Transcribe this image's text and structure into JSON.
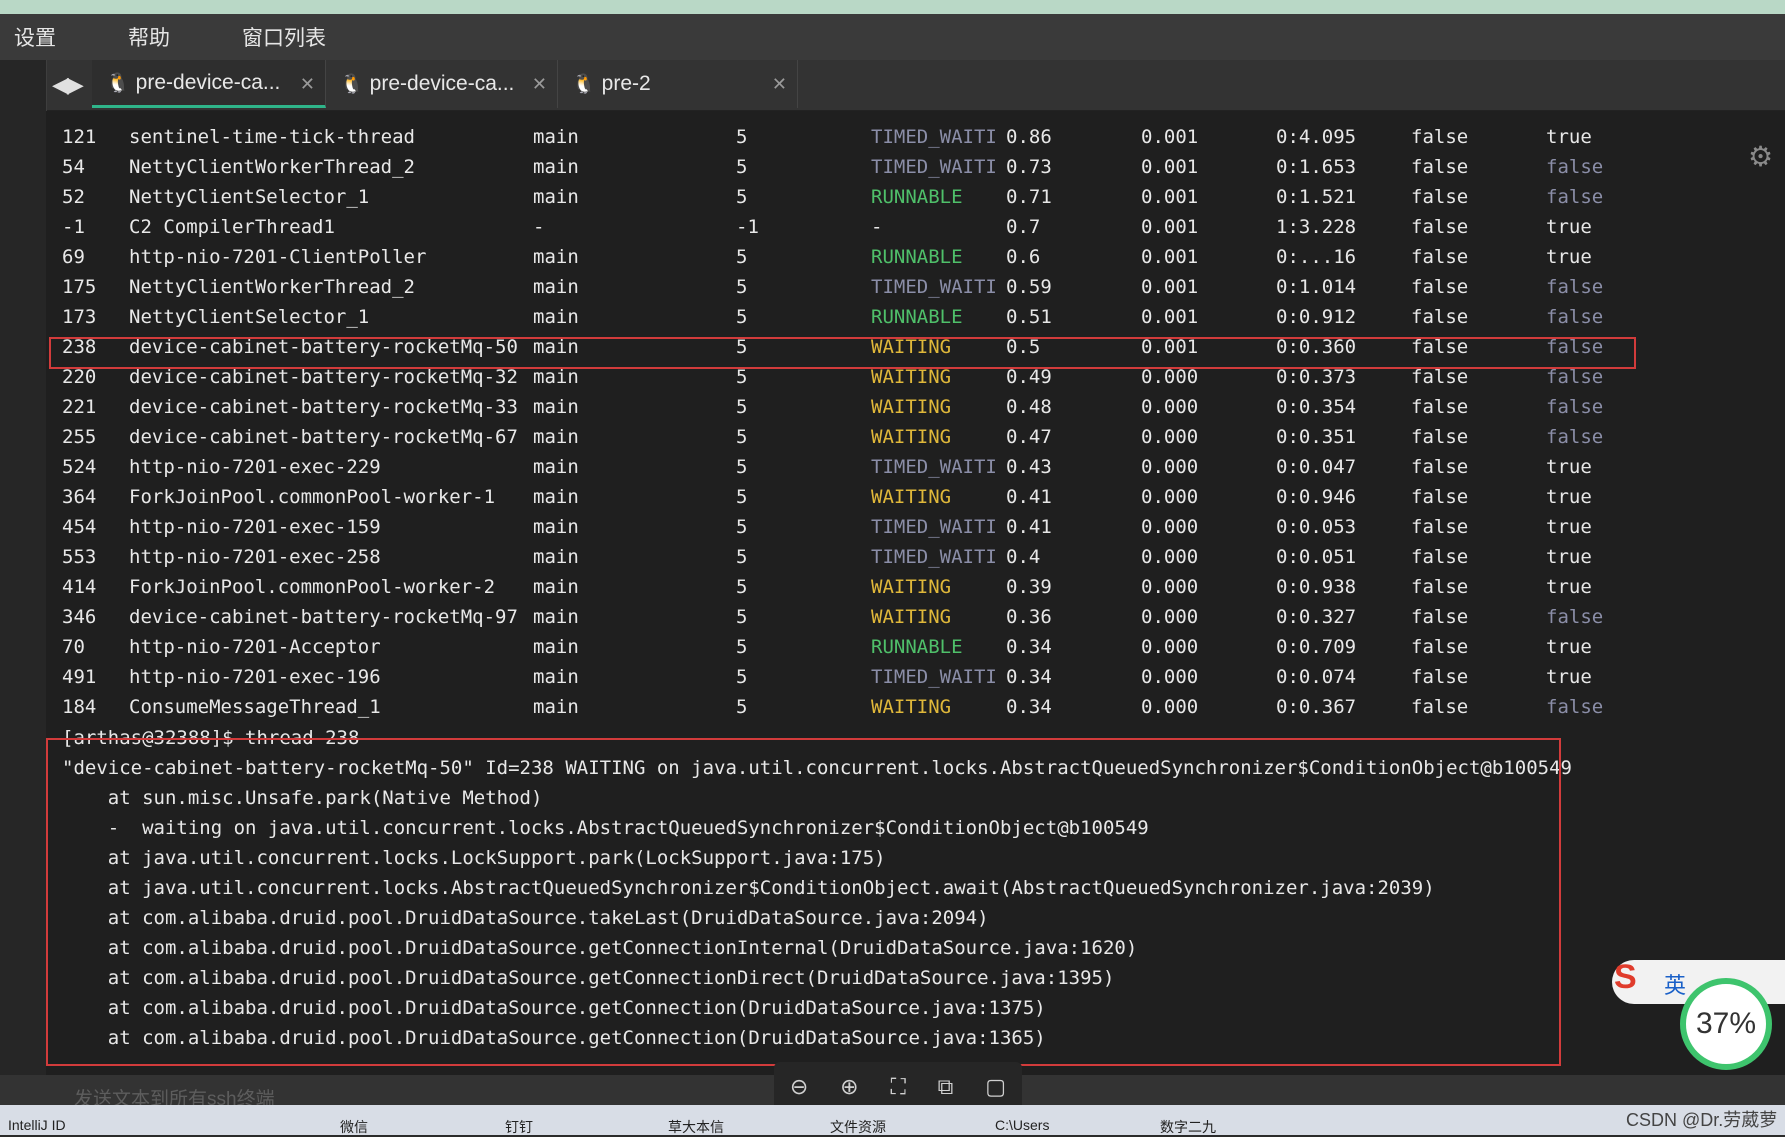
{
  "menu": [
    "设置",
    "帮助",
    "窗口列表"
  ],
  "tabs": [
    {
      "label": "pre-device-ca...",
      "active": true
    },
    {
      "label": "pre-device-ca...",
      "active": false
    },
    {
      "label": "pre-2",
      "active": false
    }
  ],
  "threads": [
    {
      "id": "121",
      "name": "sentinel-time-tick-thread",
      "group": "main",
      "priority": "5",
      "state": "TIMED_WAITI",
      "cpu": "0.86",
      "delta": "0.001",
      "time": "0:4.095",
      "interrupted": "false",
      "daemon": "true"
    },
    {
      "id": "54",
      "name": "NettyClientWorkerThread_2",
      "group": "main",
      "priority": "5",
      "state": "TIMED_WAITI",
      "cpu": "0.73",
      "delta": "0.001",
      "time": "0:1.653",
      "interrupted": "false",
      "daemon": "false"
    },
    {
      "id": "52",
      "name": "NettyClientSelector_1",
      "group": "main",
      "priority": "5",
      "state": "RUNNABLE",
      "cpu": "0.71",
      "delta": "0.001",
      "time": "0:1.521",
      "interrupted": "false",
      "daemon": "false"
    },
    {
      "id": "-1",
      "name": "C2 CompilerThread1",
      "group": "-",
      "priority": "-1",
      "state": "-",
      "cpu": "0.7",
      "delta": "0.001",
      "time": "1:3.228",
      "interrupted": "false",
      "daemon": "true"
    },
    {
      "id": "69",
      "name": "http-nio-7201-ClientPoller",
      "group": "main",
      "priority": "5",
      "state": "RUNNABLE",
      "cpu": "0.6",
      "delta": "0.001",
      "time": "0:...16",
      "interrupted": "false",
      "daemon": "true"
    },
    {
      "id": "175",
      "name": "NettyClientWorkerThread_2",
      "group": "main",
      "priority": "5",
      "state": "TIMED_WAITI",
      "cpu": "0.59",
      "delta": "0.001",
      "time": "0:1.014",
      "interrupted": "false",
      "daemon": "false"
    },
    {
      "id": "173",
      "name": "NettyClientSelector_1",
      "group": "main",
      "priority": "5",
      "state": "RUNNABLE",
      "cpu": "0.51",
      "delta": "0.001",
      "time": "0:0.912",
      "interrupted": "false",
      "daemon": "false"
    },
    {
      "id": "238",
      "name": "device-cabinet-battery-rocketMq-50",
      "group": "main",
      "priority": "5",
      "state": "WAITING",
      "cpu": "0.5",
      "delta": "0.001",
      "time": "0:0.360",
      "interrupted": "false",
      "daemon": "false"
    },
    {
      "id": "220",
      "name": "device-cabinet-battery-rocketMq-32",
      "group": "main",
      "priority": "5",
      "state": "WAITING",
      "cpu": "0.49",
      "delta": "0.000",
      "time": "0:0.373",
      "interrupted": "false",
      "daemon": "false"
    },
    {
      "id": "221",
      "name": "device-cabinet-battery-rocketMq-33",
      "group": "main",
      "priority": "5",
      "state": "WAITING",
      "cpu": "0.48",
      "delta": "0.000",
      "time": "0:0.354",
      "interrupted": "false",
      "daemon": "false"
    },
    {
      "id": "255",
      "name": "device-cabinet-battery-rocketMq-67",
      "group": "main",
      "priority": "5",
      "state": "WAITING",
      "cpu": "0.47",
      "delta": "0.000",
      "time": "0:0.351",
      "interrupted": "false",
      "daemon": "false"
    },
    {
      "id": "524",
      "name": "http-nio-7201-exec-229",
      "group": "main",
      "priority": "5",
      "state": "TIMED_WAITI",
      "cpu": "0.43",
      "delta": "0.000",
      "time": "0:0.047",
      "interrupted": "false",
      "daemon": "true"
    },
    {
      "id": "364",
      "name": "ForkJoinPool.commonPool-worker-1",
      "group": "main",
      "priority": "5",
      "state": "WAITING",
      "cpu": "0.41",
      "delta": "0.000",
      "time": "0:0.946",
      "interrupted": "false",
      "daemon": "true"
    },
    {
      "id": "454",
      "name": "http-nio-7201-exec-159",
      "group": "main",
      "priority": "5",
      "state": "TIMED_WAITI",
      "cpu": "0.41",
      "delta": "0.000",
      "time": "0:0.053",
      "interrupted": "false",
      "daemon": "true"
    },
    {
      "id": "553",
      "name": "http-nio-7201-exec-258",
      "group": "main",
      "priority": "5",
      "state": "TIMED_WAITI",
      "cpu": "0.4",
      "delta": "0.000",
      "time": "0:0.051",
      "interrupted": "false",
      "daemon": "true"
    },
    {
      "id": "414",
      "name": "ForkJoinPool.commonPool-worker-2",
      "group": "main",
      "priority": "5",
      "state": "WAITING",
      "cpu": "0.39",
      "delta": "0.000",
      "time": "0:0.938",
      "interrupted": "false",
      "daemon": "true"
    },
    {
      "id": "346",
      "name": "device-cabinet-battery-rocketMq-97",
      "group": "main",
      "priority": "5",
      "state": "WAITING",
      "cpu": "0.36",
      "delta": "0.000",
      "time": "0:0.327",
      "interrupted": "false",
      "daemon": "false"
    },
    {
      "id": "70",
      "name": "http-nio-7201-Acceptor",
      "group": "main",
      "priority": "5",
      "state": "RUNNABLE",
      "cpu": "0.34",
      "delta": "0.000",
      "time": "0:0.709",
      "interrupted": "false",
      "daemon": "true"
    },
    {
      "id": "491",
      "name": "http-nio-7201-exec-196",
      "group": "main",
      "priority": "5",
      "state": "TIMED_WAITI",
      "cpu": "0.34",
      "delta": "0.000",
      "time": "0:0.074",
      "interrupted": "false",
      "daemon": "true"
    },
    {
      "id": "184",
      "name": "ConsumeMessageThread_1",
      "group": "main",
      "priority": "5",
      "state": "WAITING",
      "cpu": "0.34",
      "delta": "0.000",
      "time": "0:0.367",
      "interrupted": "false",
      "daemon": "false"
    }
  ],
  "trace": {
    "prompt": "[arthas@32388]$ thread 238",
    "header": "\"device-cabinet-battery-rocketMq-50\" Id=238 WAITING on java.util.concurrent.locks.AbstractQueuedSynchronizer$ConditionObject@b100549",
    "lines": [
      "    at sun.misc.Unsafe.park(Native Method)",
      "    -  waiting on java.util.concurrent.locks.AbstractQueuedSynchronizer$ConditionObject@b100549",
      "    at java.util.concurrent.locks.LockSupport.park(LockSupport.java:175)",
      "    at java.util.concurrent.locks.AbstractQueuedSynchronizer$ConditionObject.await(AbstractQueuedSynchronizer.java:2039)",
      "    at com.alibaba.druid.pool.DruidDataSource.takeLast(DruidDataSource.java:2094)",
      "    at com.alibaba.druid.pool.DruidDataSource.getConnectionInternal(DruidDataSource.java:1620)",
      "    at com.alibaba.druid.pool.DruidDataSource.getConnectionDirect(DruidDataSource.java:1395)",
      "    at com.alibaba.druid.pool.DruidDataSource.getConnection(DruidDataSource.java:1375)",
      "    at com.alibaba.druid.pool.DruidDataSource.getConnection(DruidDataSource.java:1365)"
    ]
  },
  "send_placeholder": "发送文本到所有ssh终端",
  "ime": {
    "logo": "S",
    "lang": "英"
  },
  "gauge": "37%",
  "watermark": "CSDN @Dr.劳葳萝",
  "taskbar": [
    "IntelliJ ID",
    "微信",
    "钉钉",
    "草大本信",
    "文件资源",
    "C:\\Users",
    "数字二九"
  ],
  "colors": {
    "runnable": "#4fc06a",
    "waiting": "#e0b83a",
    "timed_waiting": "#8b8ea8",
    "highlight": "#d23b3b",
    "tab_accent": "#2fb58a"
  }
}
